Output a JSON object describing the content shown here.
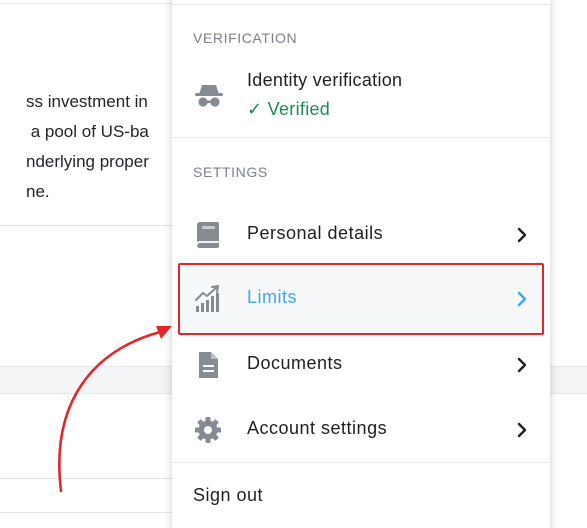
{
  "background": {
    "text_lines": [
      "ss investment in",
      " a pool of US-ba",
      "nderlying proper",
      "ne."
    ]
  },
  "menu": {
    "verification_header": "VERIFICATION",
    "identity": {
      "title": "Identity verification",
      "status": "✓ Verified",
      "icon": "incognito-spy-icon"
    },
    "settings_header": "SETTINGS",
    "items": [
      {
        "label": "Personal details",
        "icon": "passport-book-icon"
      },
      {
        "label": "Limits",
        "icon": "rising-bars-chart-icon",
        "active": true
      },
      {
        "label": "Documents",
        "icon": "document-icon"
      },
      {
        "label": "Account settings",
        "icon": "gear-icon"
      }
    ],
    "sign_out": "Sign out"
  },
  "colors": {
    "accent": "#3ea6f0",
    "verified_green": "#1e8a52",
    "annotation_red": "#e0282a"
  }
}
